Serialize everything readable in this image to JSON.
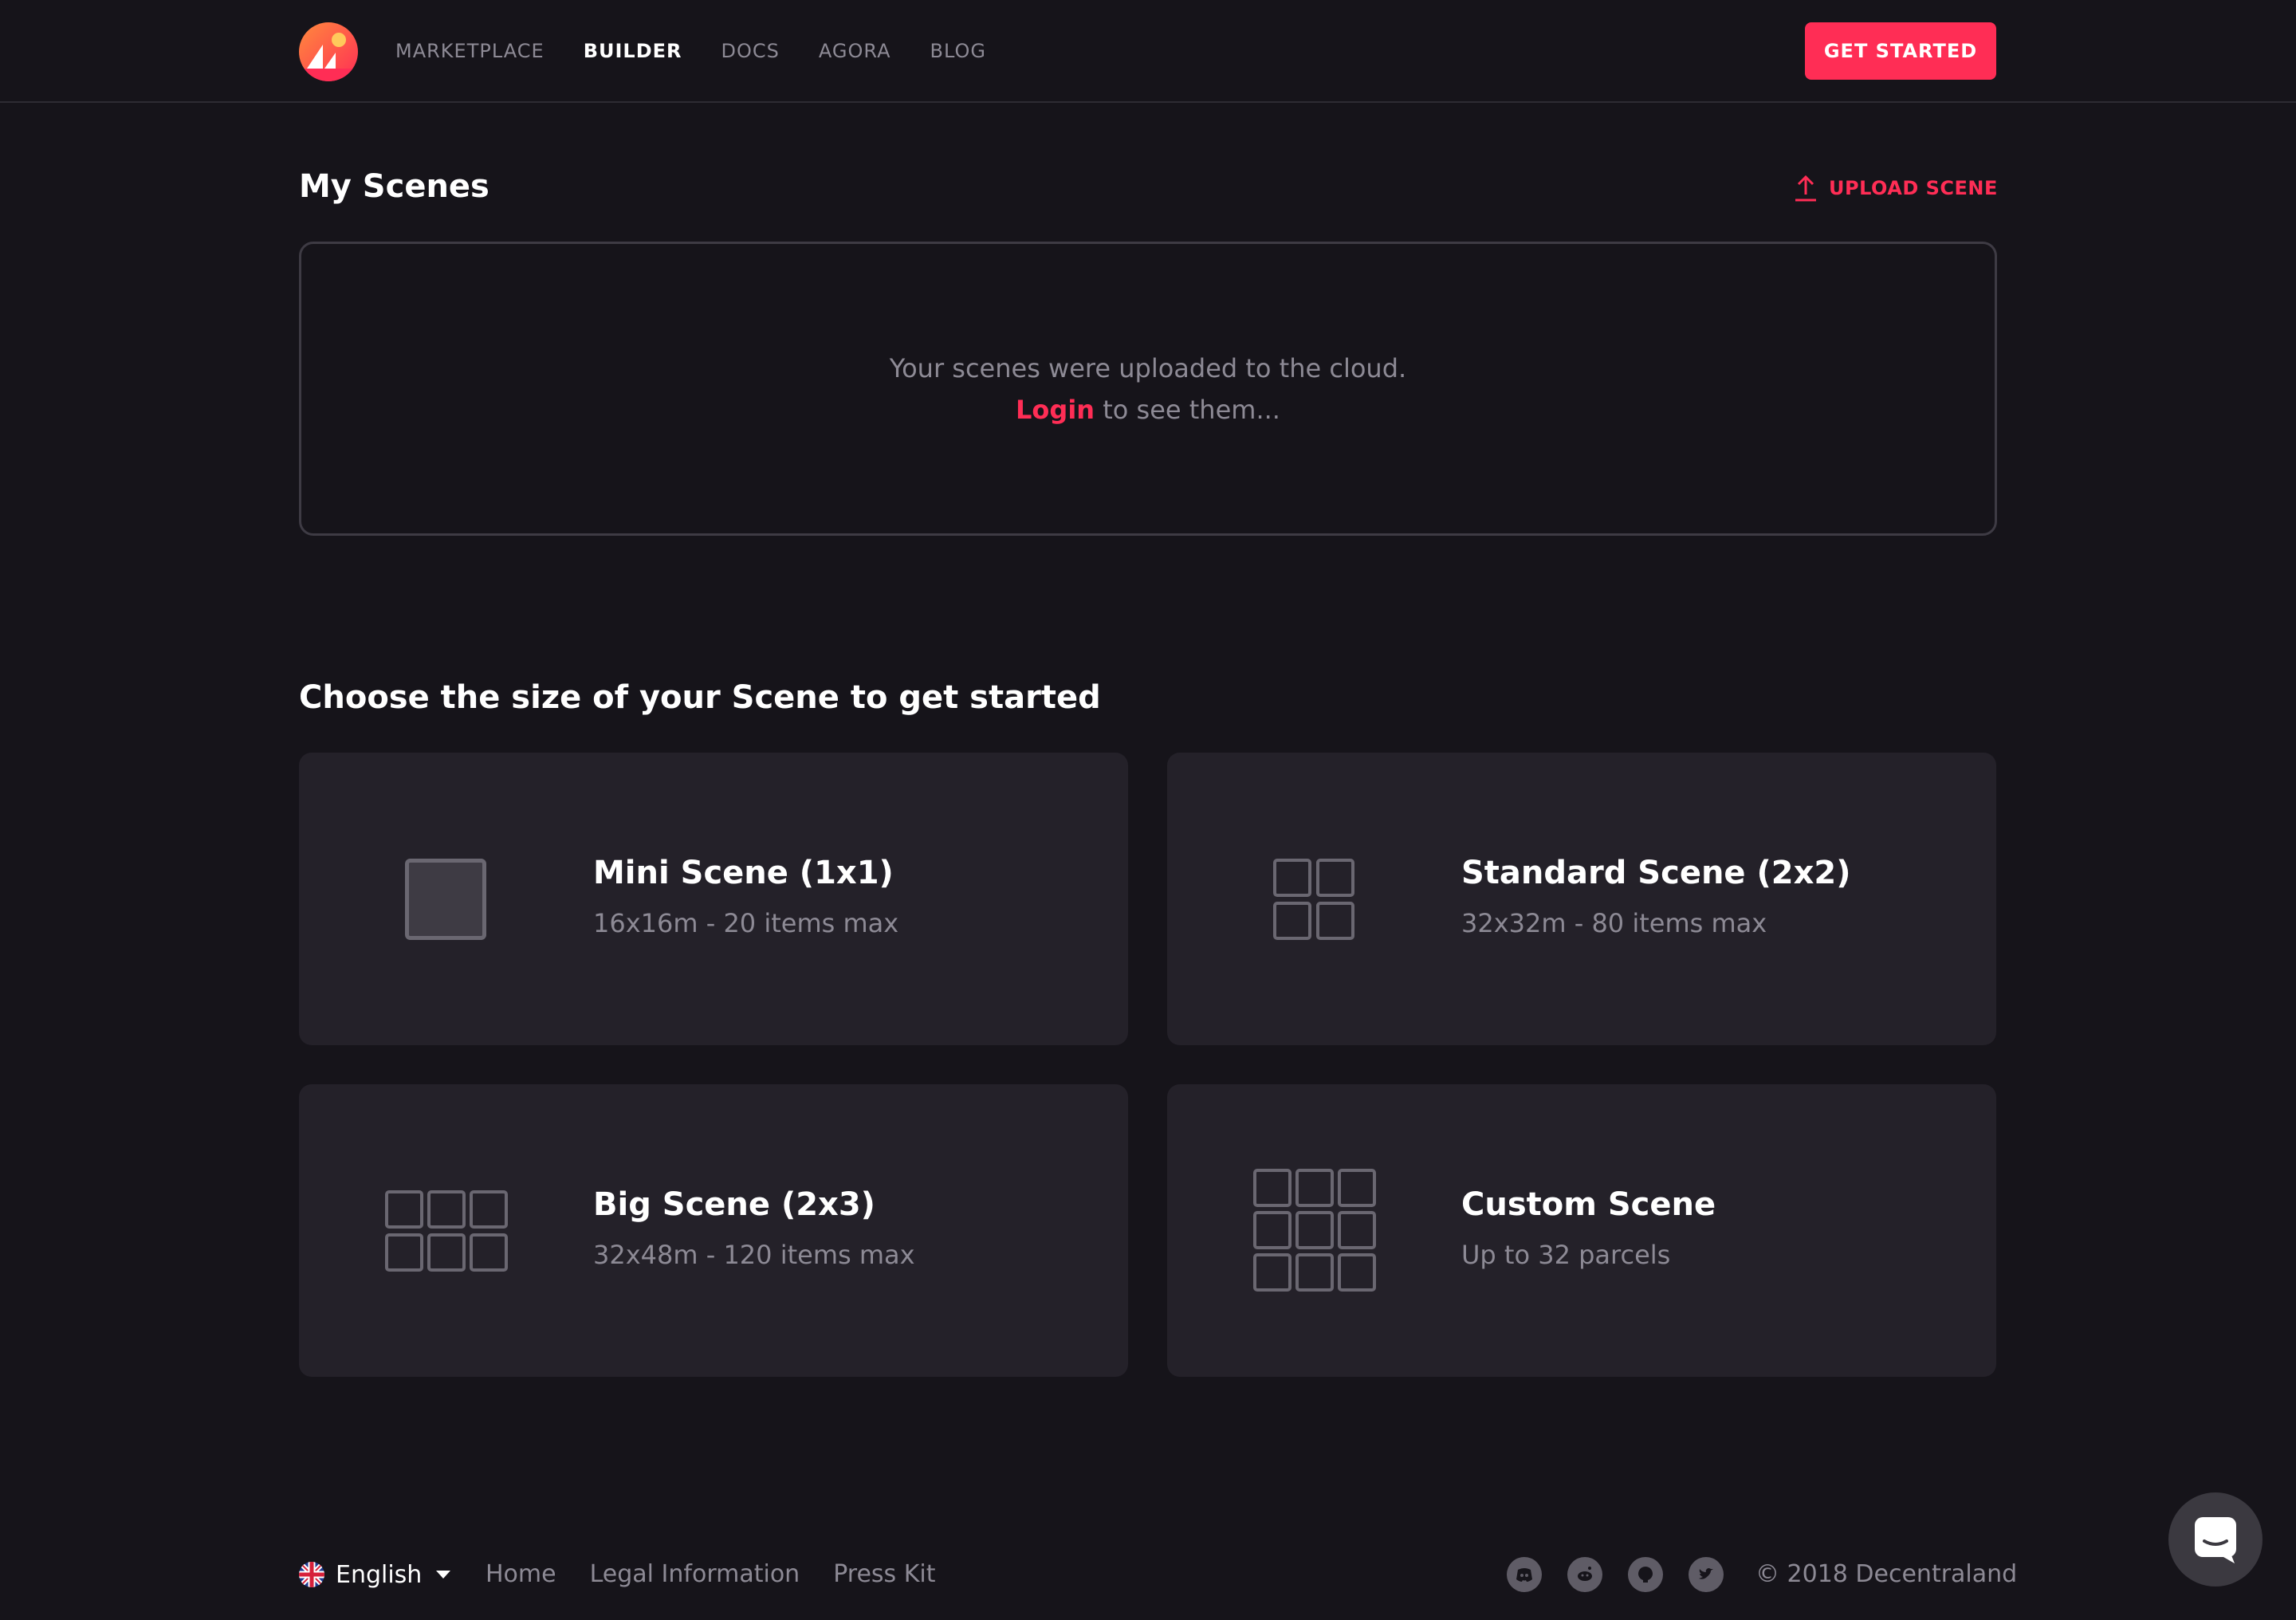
{
  "nav": {
    "logo_icon": "decentraland-logo",
    "links": [
      "MARKETPLACE",
      "BUILDER",
      "DOCS",
      "AGORA",
      "BLOG"
    ],
    "active": "BUILDER",
    "cta_label": "GET STARTED"
  },
  "my_scenes": {
    "title": "My Scenes",
    "upload_label": "UPLOAD SCENE",
    "upload_icon": "upload-icon",
    "cloud_message": "Your scenes were uploaded to the cloud.",
    "login_label": "Login",
    "login_suffix": " to see them..."
  },
  "size_section": {
    "title": "Choose the size of your Scene to get started",
    "cards": [
      {
        "title": "Mini Scene (1x1)",
        "subtitle": "16x16m - 20 items max",
        "icon": "grid-1x1-icon"
      },
      {
        "title": "Standard Scene (2x2)",
        "subtitle": "32x32m - 80 items max",
        "icon": "grid-2x2-icon"
      },
      {
        "title": "Big Scene (2x3)",
        "subtitle": "32x48m - 120 items max",
        "icon": "grid-2x3-icon"
      },
      {
        "title": "Custom Scene",
        "subtitle": "Up to 32 parcels",
        "icon": "grid-3x3-icon"
      }
    ]
  },
  "footer": {
    "language": "English",
    "links": [
      "Home",
      "Legal Information",
      "Press Kit"
    ],
    "social_icons": [
      "discord-icon",
      "reddit-icon",
      "github-icon",
      "twitter-icon"
    ],
    "copyright": "© 2018 Decentraland"
  },
  "colors": {
    "background": "#16141a",
    "accent": "#ff2d55",
    "card": "#242129",
    "muted_text": "#8d8a95"
  }
}
